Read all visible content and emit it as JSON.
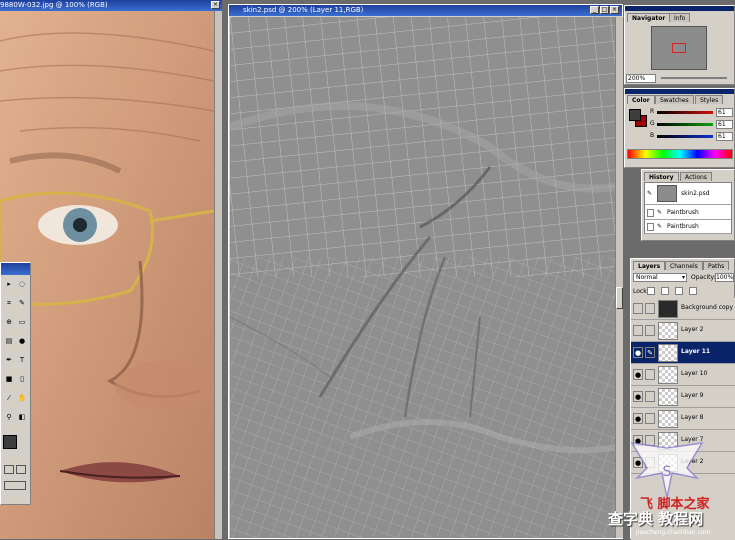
{
  "photo_window": {
    "title": "9880W-032.jpg @ 100% (RGB)"
  },
  "main_window": {
    "title": "skin2.psd @ 200% (Layer 11,RGB)"
  },
  "navigator": {
    "tabs": [
      "Navigator",
      "Info"
    ],
    "zoom": "200%"
  },
  "color": {
    "tabs": [
      "Color",
      "Swatches",
      "Styles"
    ],
    "channels": [
      {
        "label": "R",
        "value": "61",
        "track": "#d01010"
      },
      {
        "label": "G",
        "value": "61",
        "track": "#10a010"
      },
      {
        "label": "B",
        "value": "61",
        "track": "#1030d0"
      }
    ],
    "foreground": "#3d3d3d",
    "background": "#a00000"
  },
  "history": {
    "tabs": [
      "History",
      "Actions"
    ],
    "snapshot": "skin2.psd",
    "items": [
      "Paintbrush",
      "Paintbrush"
    ]
  },
  "layers": {
    "tabs": [
      "Layers",
      "Channels",
      "Paths"
    ],
    "blend_mode": "Normal",
    "opacity_label": "Opacity:",
    "opacity": "100%",
    "lock_label": "Lock:",
    "rows": [
      {
        "name": "Background copy",
        "visible": false,
        "selected": false
      },
      {
        "name": "Layer 2",
        "visible": false,
        "selected": false
      },
      {
        "name": "Layer 11",
        "visible": true,
        "selected": true
      },
      {
        "name": "Layer 10",
        "visible": true,
        "selected": false
      },
      {
        "name": "Layer 9",
        "visible": true,
        "selected": false
      },
      {
        "name": "Layer 8",
        "visible": true,
        "selected": false
      },
      {
        "name": "Layer 7",
        "visible": true,
        "selected": false
      },
      {
        "name": "Layer 2",
        "visible": true,
        "selected": false
      }
    ]
  },
  "watermark": {
    "line1": "飞 脚本之家",
    "line2": "查字典 教程网",
    "line3": "jiaocheng.chazidian.com"
  },
  "toolbox": {
    "tools": [
      "move-icon",
      "lasso-icon",
      "crop-icon",
      "brush-icon",
      "clone-icon",
      "eraser-icon",
      "gradient-icon",
      "dodge-icon",
      "pen-icon",
      "type-icon",
      "shape-icon",
      "notes-icon",
      "eyedropper-icon",
      "hand-icon",
      "zoom-icon",
      "mask-icon"
    ],
    "glyphs": [
      "▸",
      "◌",
      "⌗",
      "✎",
      "⊕",
      "▭",
      "▤",
      "●",
      "✒",
      "T",
      "■",
      "▯",
      "⁄",
      "✋",
      "⚲",
      "◧"
    ]
  }
}
